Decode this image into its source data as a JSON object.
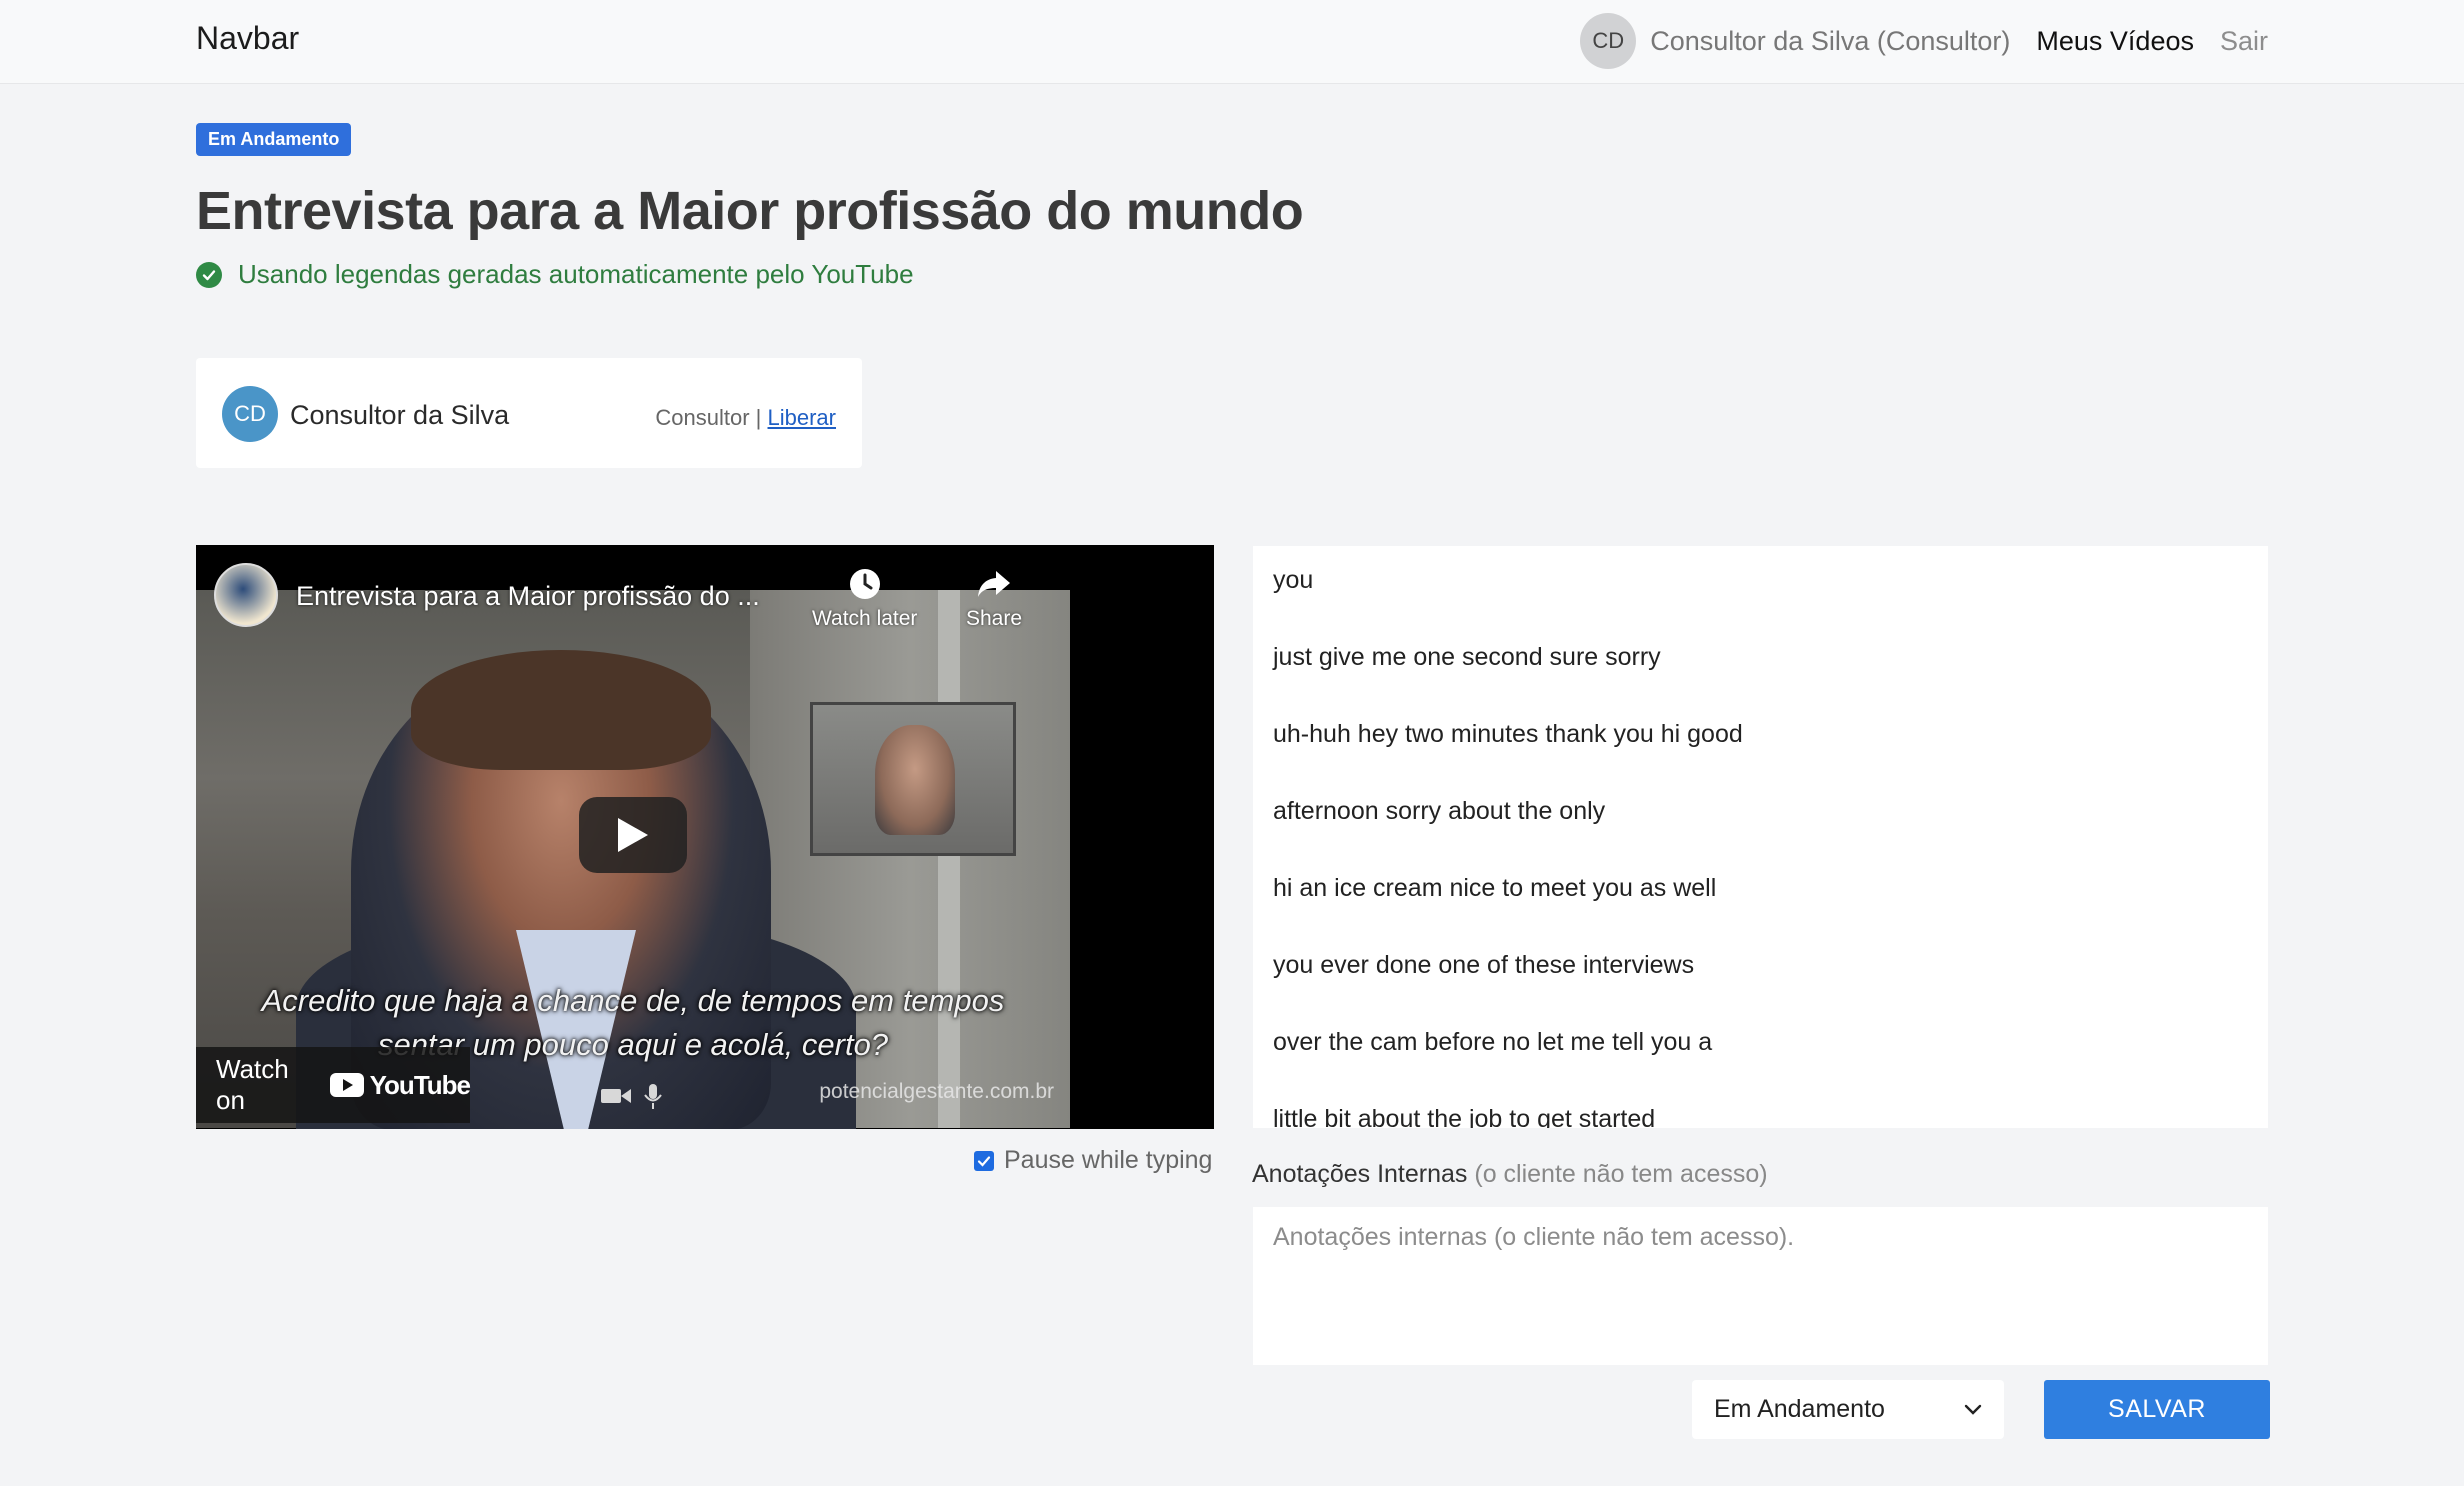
{
  "navbar": {
    "brand": "Navbar",
    "user_initials": "CD",
    "user_name": "Consultor da Silva (Consultor)",
    "my_videos": "Meus Vídeos",
    "logout": "Sair"
  },
  "header": {
    "status_badge": "Em Andamento",
    "title": "Entrevista para a Maior profissão do mundo",
    "subtitle_note": "Usando legendas geradas automaticamente pelo YouTube"
  },
  "consultant": {
    "initials": "CD",
    "name": "Consultor da Silva",
    "role": "Consultor",
    "separator": "|",
    "release_link": "Liberar"
  },
  "video": {
    "title": "Entrevista para a Maior profissão do ...",
    "watch_later": "Watch later",
    "share": "Share",
    "watch_on": "Watch on",
    "youtube": "YouTube",
    "caption_line1": "Acredito que haja a chance de, de tempos em tempos",
    "caption_line2": "sentar um pouco aqui e acolá, certo?",
    "watermark": "potencialgestante.com.br",
    "pause_while_typing": "Pause while typing",
    "pause_checked": true
  },
  "transcript": [
    "you",
    "just give me one second sure sorry",
    "uh-huh hey two minutes thank you hi good",
    "afternoon sorry about the only",
    "hi an ice cream nice to meet you as well",
    "you ever done one of these interviews",
    "over the cam before no let me tell you a",
    "little bit about the job to get started"
  ],
  "notes": {
    "label": "Anotações Internas",
    "label_hint": "(o cliente não tem acesso)",
    "placeholder": "Anotações internas (o cliente não tem acesso).",
    "value": ""
  },
  "actions": {
    "status_select": "Em Andamento",
    "save_label": "SALVAR"
  },
  "colors": {
    "badge": "#2f6fdc",
    "success": "#2f8a45",
    "save_button": "#2f7fe0",
    "link": "#1f5fc4"
  }
}
